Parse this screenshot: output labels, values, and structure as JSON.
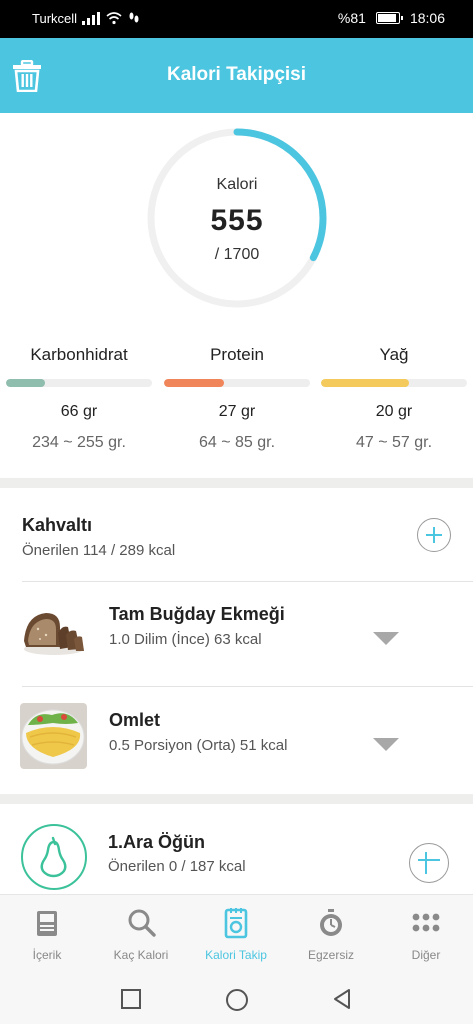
{
  "status_bar": {
    "carrier": "Turkcell",
    "battery": "%81",
    "time": "18:06"
  },
  "header": {
    "title": "Kalori Takipçisi",
    "delete_icon": "trash-icon"
  },
  "calories": {
    "label": "Kalori",
    "value": "555",
    "target": "/ 1700",
    "progress": 0.326,
    "ring_color": "#4cc5e0"
  },
  "macros": [
    {
      "name": "Karbonhidrat",
      "amount": "66 gr",
      "range": "234 ~ 255 gr.",
      "progress": 0.27,
      "color": "#8fbdae"
    },
    {
      "name": "Protein",
      "amount": "27 gr",
      "range": "64 ~ 85 gr.",
      "progress": 0.41,
      "color": "#f0855a"
    },
    {
      "name": "Yağ",
      "amount": "20 gr",
      "range": "47 ~ 57 gr.",
      "progress": 0.6,
      "color": "#f3ca5b"
    }
  ],
  "breakfast": {
    "title": "Kahvaltı",
    "subtitle": "Önerilen 114 / 289 kcal",
    "items": [
      {
        "name": "Tam Buğday Ekmeği",
        "detail": "1.0 Dilim (İnce) 63 kcal",
        "image": "bread"
      },
      {
        "name": "Omlet",
        "detail": "0.5 Porsiyon (Orta) 51 kcal",
        "image": "omelette"
      }
    ]
  },
  "snack1": {
    "title": "1.Ara Öğün",
    "subtitle": "Önerilen 0 / 187 kcal",
    "icon": "pear-icon"
  },
  "bottom_nav": [
    {
      "label": "İçerik",
      "icon": "book-icon",
      "active": false
    },
    {
      "label": "Kaç Kalori",
      "icon": "search-icon",
      "active": false
    },
    {
      "label": "Kalori Takip",
      "icon": "food-scale-icon",
      "active": true
    },
    {
      "label": "Egzersiz",
      "icon": "stopwatch-icon",
      "active": false
    },
    {
      "label": "Diğer",
      "icon": "more-dots-icon",
      "active": false
    }
  ],
  "colors": {
    "accent": "#4cc5e0",
    "pear": "#3cc29a"
  }
}
